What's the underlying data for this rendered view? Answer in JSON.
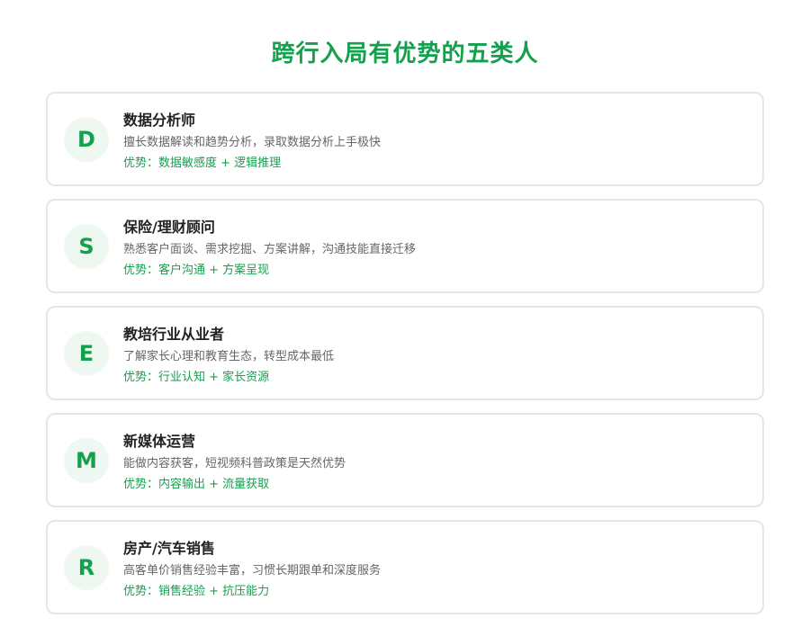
{
  "title": "跨行入局有优势的五类人",
  "cards": [
    {
      "letter": "D",
      "title": "数据分析师",
      "desc": "擅长数据解读和趋势分析，录取数据分析上手极快",
      "advantage": "优势：数据敏感度 + 逻辑推理"
    },
    {
      "letter": "S",
      "title": "保险/理财顾问",
      "desc": "熟悉客户面谈、需求挖掘、方案讲解，沟通技能直接迁移",
      "advantage": "优势：客户沟通 + 方案呈现"
    },
    {
      "letter": "E",
      "title": "教培行业从业者",
      "desc": "了解家长心理和教育生态，转型成本最低",
      "advantage": "优势：行业认知 + 家长资源"
    },
    {
      "letter": "M",
      "title": "新媒体运营",
      "desc": "能做内容获客，短视频科普政策是天然优势",
      "advantage": "优势：内容输出 + 流量获取"
    },
    {
      "letter": "R",
      "title": "房产/汽车销售",
      "desc": "高客单价销售经验丰富，习惯长期跟单和深度服务",
      "advantage": "优势：销售经验 + 抗压能力"
    }
  ],
  "colors": {
    "accent": "#15a04e",
    "avatar_bg": "#eef8f1",
    "border": "#e6e6e6"
  }
}
